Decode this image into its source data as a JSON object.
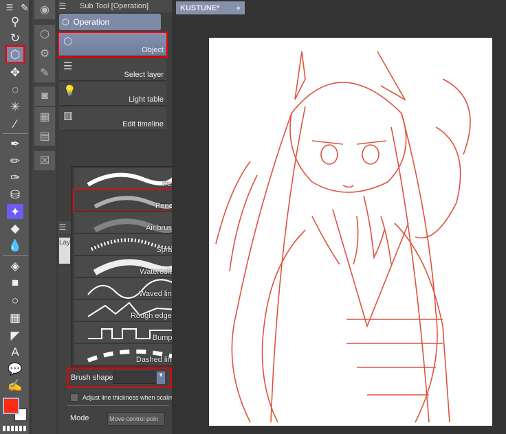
{
  "document_tab": {
    "title": "KUSTUNE*"
  },
  "sub_tool": {
    "title": "Sub Tool [Operation]",
    "group": "Operation",
    "items": [
      {
        "label": "Object"
      },
      {
        "label": "Select layer"
      },
      {
        "label": "Light table"
      },
      {
        "label": "Edit timeline"
      }
    ]
  },
  "brush_list": [
    {
      "label": "Pen"
    },
    {
      "label": "Pencil"
    },
    {
      "label": "Air brush"
    },
    {
      "label": "Spray"
    },
    {
      "label": "Watercolor"
    },
    {
      "label": "Waved line"
    },
    {
      "label": "Rough edged"
    },
    {
      "label": "Bumpy"
    },
    {
      "label": "Dashed line"
    }
  ],
  "properties": {
    "layer_tab": "Lay",
    "brush_shape_label": "Brush shape",
    "brush_shape_value": "",
    "adjust_label": "Adjust line thickness when scaling",
    "mode_label": "Mode",
    "mode_value": "Move control poin"
  },
  "colors": {
    "main": "#ff2a14",
    "sub": "#ffffff",
    "line_art": "#e0523e",
    "highlight": "#e00000"
  }
}
